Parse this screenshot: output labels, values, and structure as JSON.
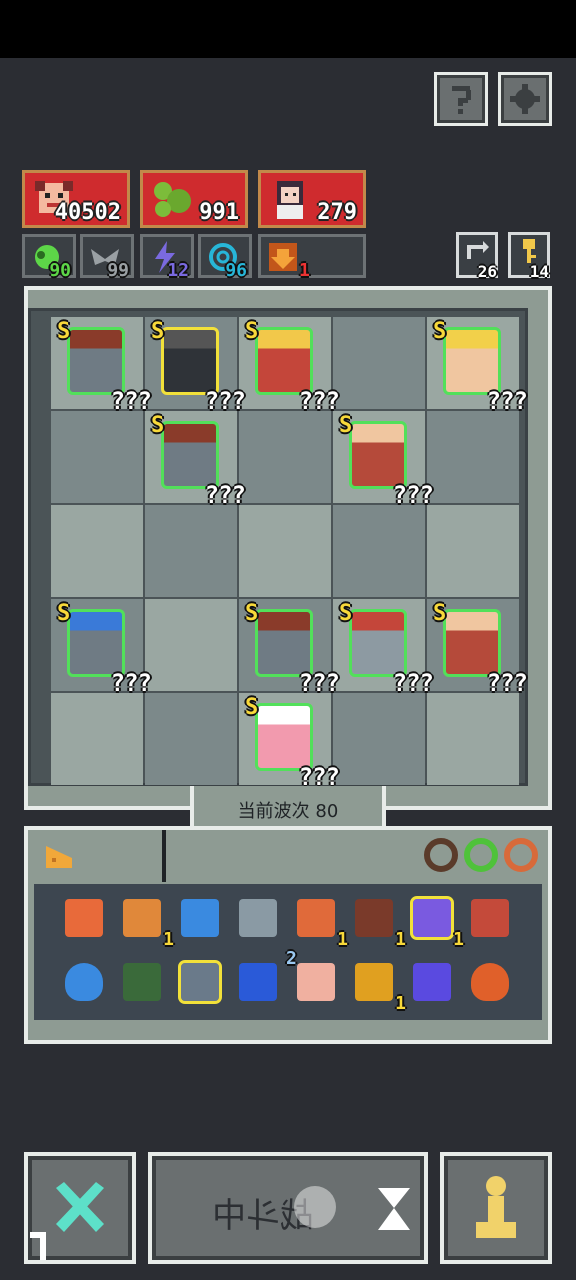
{
  "header": {
    "help_icon": "question-icon",
    "settings_icon": "gear-icon"
  },
  "resources": [
    {
      "name": "gold",
      "value": "40502",
      "icon": "boss-portrait"
    },
    {
      "name": "essence",
      "value": "991",
      "icon": "slime-portrait"
    },
    {
      "name": "souls",
      "value": "279",
      "icon": "girl-portrait"
    }
  ],
  "buffs": [
    {
      "icon": "slime-buff-icon",
      "value": "90",
      "color": "#5dd648"
    },
    {
      "icon": "wing-buff-icon",
      "value": "99",
      "color": "#9aa0a4"
    },
    {
      "icon": "lightning-buff-icon",
      "value": "12",
      "color": "#7a6ae0"
    },
    {
      "icon": "swirl-buff-icon",
      "value": "96",
      "color": "#27b6d8"
    },
    {
      "icon": "arrow-down-buff-icon",
      "value": "1",
      "color": "#e36a1a"
    }
  ],
  "counters": [
    {
      "icon": "refresh-icon",
      "value": "26"
    },
    {
      "icon": "key-icon",
      "value": "14"
    }
  ],
  "board": {
    "units": [
      {
        "row": 0,
        "col": 0,
        "rank": "S",
        "label": "???",
        "type": "shield-knight"
      },
      {
        "row": 0,
        "col": 1,
        "rank": "S",
        "label": "???",
        "type": "dark-knight"
      },
      {
        "row": 0,
        "col": 2,
        "rank": "S",
        "label": "???",
        "type": "red-king"
      },
      {
        "row": 0,
        "col": 4,
        "rank": "S",
        "label": "???",
        "type": "blonde-brawler"
      },
      {
        "row": 1,
        "col": 1,
        "rank": "S",
        "label": "???",
        "type": "shield-knight"
      },
      {
        "row": 1,
        "col": 3,
        "rank": "S",
        "label": "???",
        "type": "archer"
      },
      {
        "row": 3,
        "col": 0,
        "rank": "S",
        "label": "???",
        "type": "shield-knight-blue"
      },
      {
        "row": 3,
        "col": 2,
        "rank": "S",
        "label": "???",
        "type": "shield-knight"
      },
      {
        "row": 3,
        "col": 3,
        "rank": "S",
        "label": "???",
        "type": "crossbowman"
      },
      {
        "row": 3,
        "col": 4,
        "rank": "S",
        "label": "???",
        "type": "archer"
      },
      {
        "row": 4,
        "col": 2,
        "rank": "S",
        "label": "???",
        "type": "pink-mage"
      }
    ]
  },
  "wave": {
    "label": "当前波次 80"
  },
  "inventory": {
    "tab_icon": "cheese-icon",
    "rings": [
      "#2f9a4a",
      "#4fc23a",
      "#d86a3a"
    ],
    "items": [
      {
        "icon": "scroll-icon",
        "count": ""
      },
      {
        "icon": "eye-orb-icon",
        "count": "1"
      },
      {
        "icon": "goggles-icon",
        "count": ""
      },
      {
        "icon": "shuriken-icon",
        "count": ""
      },
      {
        "icon": "axe-icon",
        "count": "1"
      },
      {
        "icon": "totem-icon",
        "count": "1"
      },
      {
        "icon": "potion-icon",
        "count": "1"
      },
      {
        "icon": "arrow-icon",
        "count": ""
      },
      {
        "icon": "water-drop-icon",
        "count": ""
      },
      {
        "icon": "map-icon",
        "count": ""
      },
      {
        "icon": "claw-icon",
        "count": ""
      },
      {
        "icon": "blue-orb-icon",
        "count": ""
      },
      {
        "icon": "hand-icon",
        "count": "2"
      },
      {
        "icon": "planet-icon",
        "count": "1"
      },
      {
        "icon": "portal-icon",
        "count": ""
      },
      {
        "icon": "fire-icon",
        "count": ""
      }
    ]
  },
  "actions": {
    "close_icon": "cross-swords-icon",
    "fight_label": "战斗中",
    "hourglass_icon": "hourglass-icon",
    "pawn_icon": "pawn-icon"
  }
}
